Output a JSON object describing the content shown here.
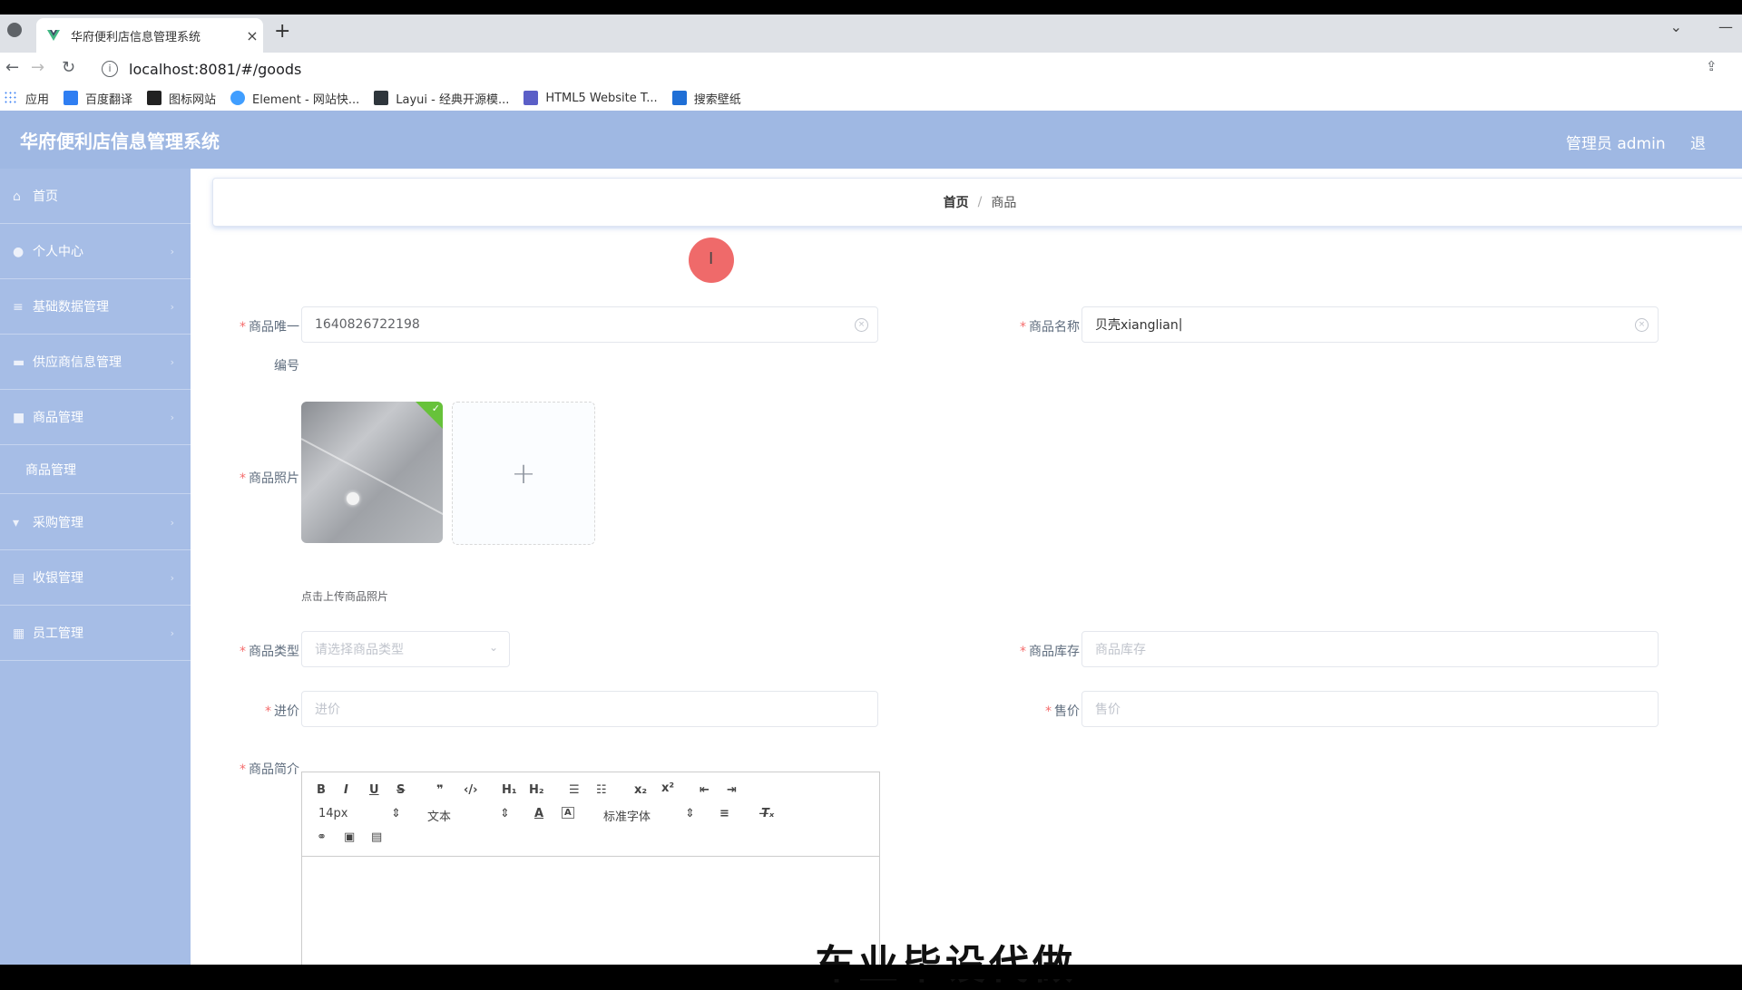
{
  "browser": {
    "tab_title": "华府便利店信息管理系统",
    "url": "localhost:8081/#/goods",
    "bookmarks": [
      "应用",
      "百度翻译",
      "图标网站",
      "Element - 网站快...",
      "Layui - 经典开源模...",
      "HTML5 Website T...",
      "搜索壁纸"
    ]
  },
  "app": {
    "brand": "华府便利店信息管理系统",
    "admin": "管理员 admin",
    "logout": "退"
  },
  "sidebar": {
    "items": [
      {
        "label": "首页",
        "icon": "home-icon"
      },
      {
        "label": "个人中心",
        "icon": "user-icon"
      },
      {
        "label": "基础数据管理",
        "icon": "list-icon"
      },
      {
        "label": "供应商信息管理",
        "icon": "briefcase-icon"
      },
      {
        "label": "商品管理",
        "icon": "box-icon"
      },
      {
        "label": "商品管理",
        "icon": ""
      },
      {
        "label": "采购管理",
        "icon": "trophy-icon"
      },
      {
        "label": "收银管理",
        "icon": "cash-icon"
      },
      {
        "label": "员工管理",
        "icon": "grid-icon"
      }
    ]
  },
  "breadcrumb": {
    "home": "首页",
    "sep": "/",
    "current": "商品"
  },
  "form": {
    "goods_id_label_1": "商品唯一",
    "goods_id_label_2": "编号",
    "goods_id_value": "1640826722198",
    "goods_name_label": "商品名称",
    "goods_name_value": "贝壳xianglian",
    "photo_label": "商品照片",
    "photo_tip": "点击上传商品照片",
    "type_label": "商品类型",
    "type_placeholder": "请选择商品类型",
    "stock_label": "商品库存",
    "stock_placeholder": "商品库存",
    "cost_label": "进价",
    "cost_placeholder": "进价",
    "price_label": "售价",
    "price_placeholder": "售价",
    "intro_label": "商品简介"
  },
  "editor": {
    "font_size": "14px",
    "header": "文本",
    "font": "标准字体"
  },
  "caption": "车业毕设代做",
  "colors": {
    "header": "#9fb8e3",
    "sidebar": "#a6bde6",
    "required": "#f56c6c",
    "success": "#67c23a"
  }
}
